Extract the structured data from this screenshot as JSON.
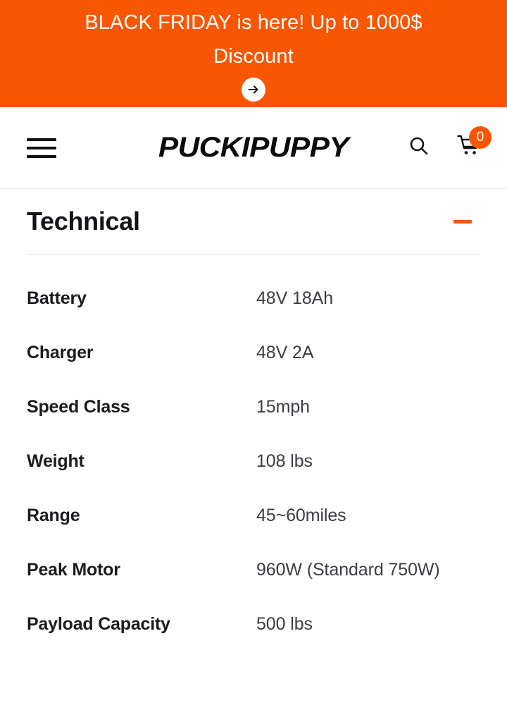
{
  "promo": {
    "text": "BLACK FRIDAY is here! Up to 1000$ Discount",
    "arrow_icon": "arrow-right-icon",
    "background_color": "#f95601",
    "text_color": "#ffffff"
  },
  "header": {
    "menu_icon": "hamburger-menu-icon",
    "brand": "PUCKIPUPPY",
    "search_icon": "search-icon",
    "cart_icon": "shopping-cart-icon",
    "cart_count": "0",
    "badge_color": "#f95601"
  },
  "accordion": {
    "title": "Technical",
    "toggle_icon": "minus-icon",
    "toggle_color": "#f95601",
    "expanded": true
  },
  "specs": [
    {
      "label": "Battery",
      "value": "48V 18Ah"
    },
    {
      "label": "Charger",
      "value": "48V 2A"
    },
    {
      "label": "Speed Class",
      "value": "15mph"
    },
    {
      "label": "Weight",
      "value": "108 lbs"
    },
    {
      "label": "Range",
      "value": "45~60miles"
    },
    {
      "label": "Peak Motor",
      "value": "960W (Standard 750W)"
    },
    {
      "label": "Payload Capacity",
      "value": "500 lbs"
    }
  ]
}
